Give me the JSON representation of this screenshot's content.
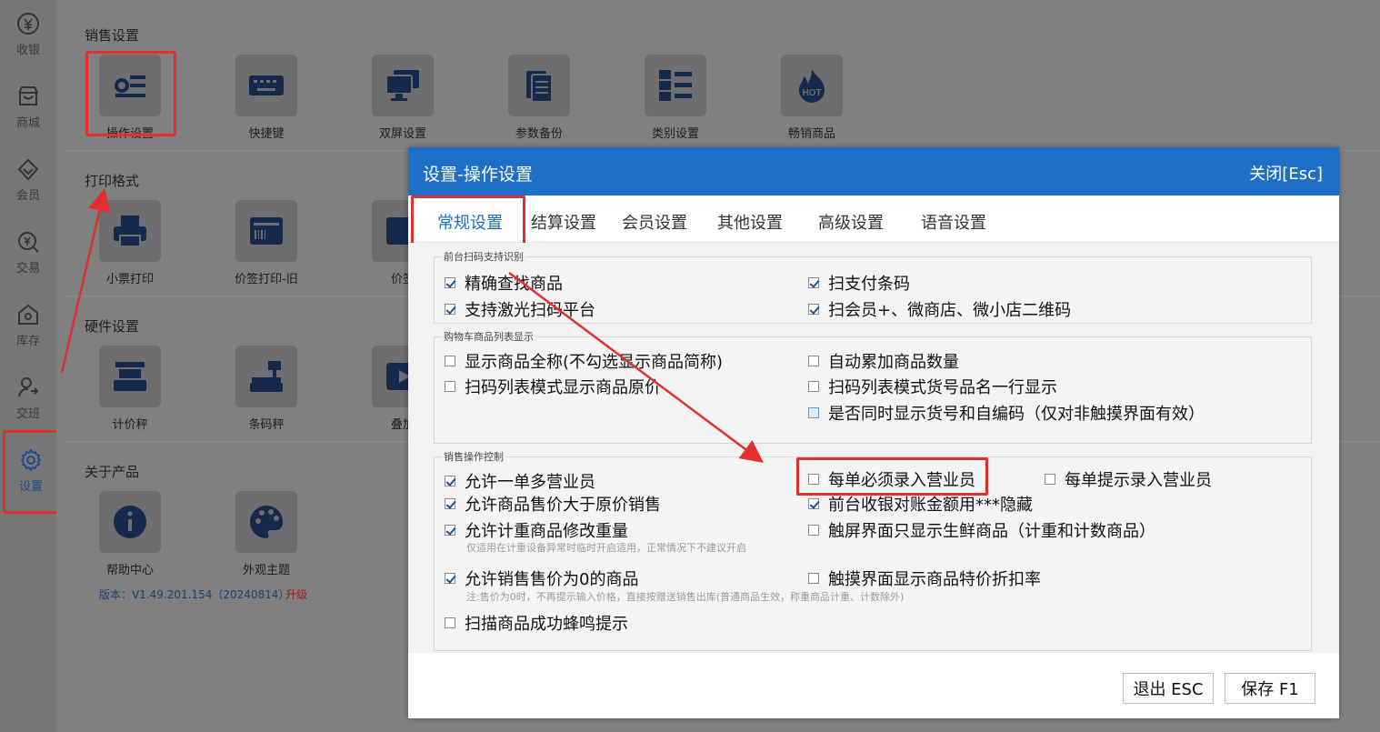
{
  "sidebar": {
    "items": [
      {
        "label": "收银",
        "icon": "yen-bag-icon"
      },
      {
        "label": "商城",
        "icon": "store-icon"
      },
      {
        "label": "会员",
        "icon": "member-diamond-icon"
      },
      {
        "label": "交易",
        "icon": "yen-search-icon"
      },
      {
        "label": "库存",
        "icon": "warehouse-icon"
      },
      {
        "label": "交班",
        "icon": "handover-icon"
      },
      {
        "label": "设置",
        "icon": "gear-icon"
      }
    ],
    "active": "设置"
  },
  "background": {
    "sections": [
      {
        "title": "销售设置",
        "tiles": [
          "操作设置",
          "快捷键",
          "双屏设置",
          "参数备份",
          "类别设置",
          "畅销商品"
        ]
      },
      {
        "title": "打印格式",
        "tiles": [
          "小票打印",
          "价签打印-旧",
          "价签"
        ]
      },
      {
        "title": "硬件设置",
        "tiles": [
          "计价秤",
          "条码秤",
          "叠加"
        ]
      },
      {
        "title": "关于产品",
        "tiles": [
          "帮助中心",
          "外观主题"
        ]
      }
    ],
    "hot_badge": "HOT",
    "version": "版本：V1.49.201.154（20240814）",
    "upgrade": "升级"
  },
  "dialog": {
    "title": "设置-操作设置",
    "close": "关闭[Esc]",
    "tabs": [
      "常规设置",
      "结算设置",
      "会员设置",
      "其他设置",
      "高级设置",
      "语音设置"
    ],
    "active_tab": "常规设置",
    "groups": {
      "scan": {
        "title": "前台扫码支持识别",
        "items": [
          {
            "label": "精确查找商品",
            "checked": true
          },
          {
            "label": "扫支付条码",
            "checked": true
          },
          {
            "label": "支持激光扫码平台",
            "checked": true
          },
          {
            "label": "扫会员+、微商店、微小店二维码",
            "checked": true
          }
        ]
      },
      "cart": {
        "title": "购物车商品列表显示",
        "items": [
          {
            "label": "显示商品全称(不勾选显示商品简称)",
            "checked": false
          },
          {
            "label": "自动累加商品数量",
            "checked": false
          },
          {
            "label": "扫码列表模式显示商品原价",
            "checked": false
          },
          {
            "label": "扫码列表模式货号品名一行显示",
            "checked": false
          },
          {
            "label": "是否同时显示货号和自编码（仅对非触摸界面有效）",
            "checked": false
          }
        ]
      },
      "sales": {
        "title": "销售操作控制",
        "items": [
          {
            "label": "允许一单多营业员",
            "checked": true
          },
          {
            "label": "每单必须录入营业员",
            "checked": false
          },
          {
            "label": "每单提示录入营业员",
            "checked": false
          },
          {
            "label": "允许商品售价大于原价销售",
            "checked": true
          },
          {
            "label": "前台收银对账金额用***隐藏",
            "checked": true
          },
          {
            "label": "允许计重商品修改重量",
            "checked": true
          },
          {
            "label": "触屏界面只显示生鲜商品（计重和计数商品）",
            "checked": false
          },
          {
            "label": "允许销售售价为0的商品",
            "checked": true
          },
          {
            "label": "触摸界面显示商品特价折扣率",
            "checked": false
          },
          {
            "label": "扫描商品成功蜂鸣提示",
            "checked": false
          }
        ],
        "notes": [
          "仅适用在计重设备异常时临时开启适用，正常情况下不建议开启",
          "注:售价为0时，不再提示输入价格，直接按赠送销售出库(普通商品生效，称重商品计重、计数除外)"
        ]
      }
    },
    "buttons": {
      "exit": "退出 ESC",
      "save": "保存 F1"
    }
  },
  "colors": {
    "primary": "#1e6fc8",
    "annotation": "#e03030"
  }
}
